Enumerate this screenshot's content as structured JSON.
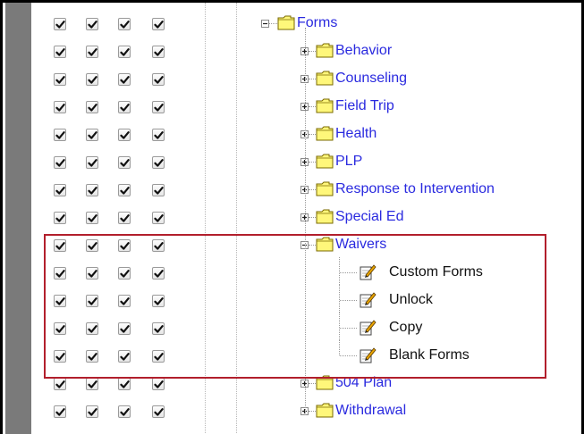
{
  "checkbox_columns": 4,
  "tree": {
    "root": {
      "label": "Forms",
      "expanded": true
    },
    "items": [
      {
        "label": "Behavior",
        "expanded": false,
        "checked": [
          true,
          true,
          true,
          true
        ]
      },
      {
        "label": "Counseling",
        "expanded": false,
        "checked": [
          true,
          true,
          true,
          true
        ]
      },
      {
        "label": "Field Trip",
        "expanded": false,
        "checked": [
          true,
          true,
          true,
          true
        ]
      },
      {
        "label": "Health",
        "expanded": false,
        "checked": [
          true,
          true,
          true,
          true
        ]
      },
      {
        "label": "PLP",
        "expanded": false,
        "checked": [
          true,
          true,
          true,
          true
        ]
      },
      {
        "label": "Response to Intervention",
        "expanded": false,
        "checked": [
          true,
          true,
          true,
          true
        ]
      },
      {
        "label": "Special Ed",
        "expanded": false,
        "checked": [
          true,
          true,
          true,
          true
        ]
      },
      {
        "label": "Waivers",
        "expanded": true,
        "highlighted": true,
        "checked": [
          true,
          true,
          true,
          true
        ],
        "children": [
          {
            "label": "Custom Forms",
            "checked": [
              true,
              true,
              true,
              true
            ]
          },
          {
            "label": "Unlock",
            "checked": [
              true,
              true,
              true,
              true
            ]
          },
          {
            "label": "Copy",
            "checked": [
              true,
              true,
              true,
              true
            ]
          },
          {
            "label": "Blank Forms",
            "checked": [
              true,
              true,
              true,
              true
            ]
          }
        ]
      },
      {
        "label": "504 Plan",
        "expanded": false,
        "checked": [
          true,
          true,
          true,
          true
        ]
      },
      {
        "label": "Withdrawal",
        "expanded": false,
        "checked": [
          true,
          true,
          true,
          true
        ]
      }
    ]
  },
  "colors": {
    "link": "#2a2adf",
    "highlight_border": "#b21f2c",
    "folder_fill": "#fff77a",
    "folder_outline": "#7a6a00"
  }
}
